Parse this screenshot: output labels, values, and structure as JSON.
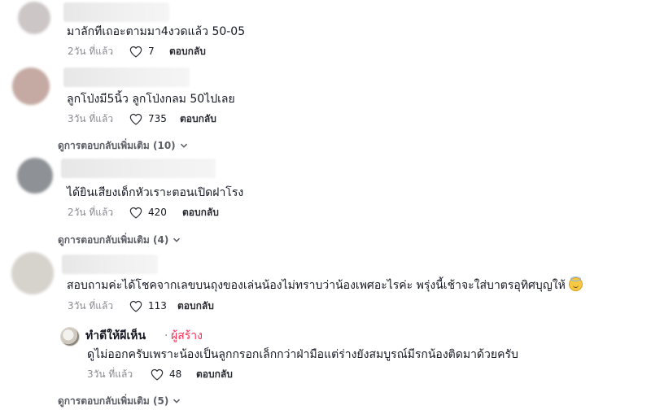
{
  "comments": [
    {
      "text": "มาลักทีเถอะตามมา4งวดแล้ว 50-05",
      "time": "2วัน ที่แล้ว",
      "likes": "7",
      "reply_label": "ตอบกลับ"
    },
    {
      "text": "ลูกโป่งมี5นิ้ว ลูกโป่งกลม 50ไปเลย",
      "time": "3วัน ที่แล้ว",
      "likes": "735",
      "reply_label": "ตอบกลับ",
      "more_replies": "ดูการตอบกลับเพิ่มเติม (10)"
    },
    {
      "text": "ได้ยินเสียงเด็กหัวเราะตอนเปิดฝาโรง",
      "time": "2วัน ที่แล้ว",
      "likes": "420",
      "reply_label": "ตอบกลับ",
      "more_replies": "ดูการตอบกลับเพิ่มเติม (4)"
    },
    {
      "text": "สอบถามค่ะได้โชคจากเลขบนถุงของเล่นน้องไม่ทราบว่าน้องเพศอะไรค่ะ พรุ่งนี้เช้าจะใส่บาตรอุทิศบุญให้",
      "time": "3วัน ที่แล้ว",
      "likes": "113",
      "reply_label": "ตอบกลับ"
    }
  ],
  "creator_reply": {
    "name": "ทำดีให้ผีเห็น",
    "separator": "·",
    "tag": "ผู้สร้าง",
    "text": "ดูไม่ออกครับเพราะน้องเป็นลูกกรอกเล็กกว่าฝ่ามือแต่ร่างยังสมบูรณ์มีรกน้องติดมาด้วยครับ",
    "time": "3วัน ที่แล้ว",
    "likes": "48",
    "reply_label": "ตอบกลับ"
  },
  "final_more_replies": "ดูการตอบกลับเพิ่มเติม (5)",
  "icons": {
    "like": "heart-outline-icon",
    "expand": "chevron-down-icon",
    "emoji": "smiling-face-with-halo-emoji"
  },
  "colors": {
    "creator_tag": "#fe2c55",
    "meta_text": "#8a8b91",
    "body_text": "#161823"
  }
}
